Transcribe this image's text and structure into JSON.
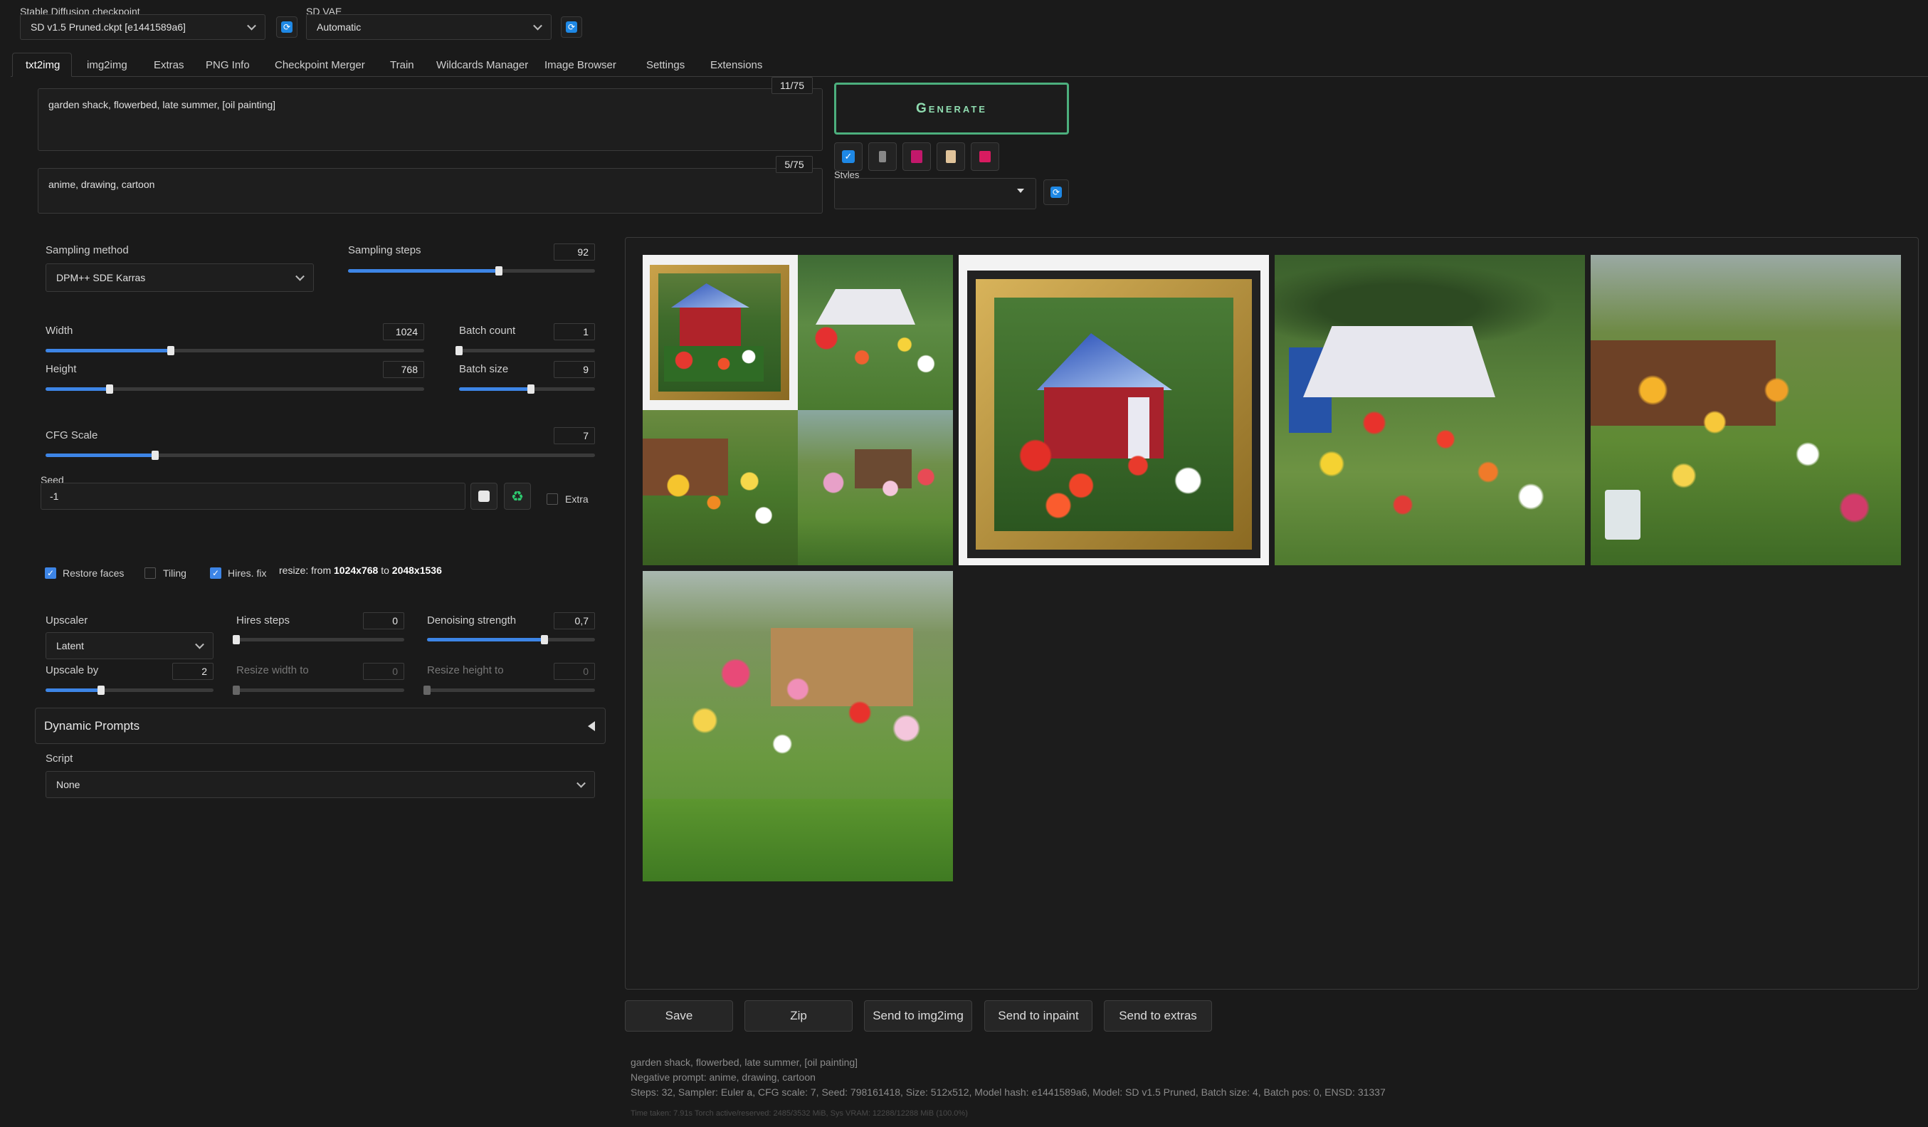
{
  "header": {
    "checkpoint_label": "Stable Diffusion checkpoint",
    "checkpoint_value": "SD v1.5 Pruned.ckpt [e1441589a6]",
    "vae_label": "SD VAE",
    "vae_value": "Automatic"
  },
  "tabs": [
    "txt2img",
    "img2img",
    "Extras",
    "PNG Info",
    "Checkpoint Merger",
    "Train",
    "Wildcards Manager",
    "Image Browser",
    "Settings",
    "Extensions"
  ],
  "prompt": {
    "positive": "garden shack, flowerbed, late summer, [oil painting]",
    "positive_count": "11/75",
    "negative": "anime, drawing, cartoon",
    "negative_count": "5/75"
  },
  "generate_label": "Generate",
  "styles_label": "Styles",
  "sampling": {
    "method_label": "Sampling method",
    "method_value": "DPM++ SDE Karras",
    "steps_label": "Sampling steps",
    "steps_value": "92",
    "steps_fraction": 0.61
  },
  "dims": {
    "width_label": "Width",
    "width_value": "1024",
    "width_fraction": 0.33,
    "height_label": "Height",
    "height_value": "768",
    "height_fraction": 0.17,
    "batch_count_label": "Batch count",
    "batch_count_value": "1",
    "batch_count_fraction": 0.0,
    "batch_size_label": "Batch size",
    "batch_size_value": "9",
    "batch_size_fraction": 0.53
  },
  "cfg": {
    "label": "CFG Scale",
    "value": "7",
    "fraction": 0.2
  },
  "seed": {
    "label": "Seed",
    "value": "-1",
    "extra_label": "Extra"
  },
  "options": {
    "restore_faces": "Restore faces",
    "tiling": "Tiling",
    "hires_fix": "Hires. fix",
    "resize_prefix": "resize: from",
    "resize_from": "1024x768",
    "resize_to_word": "to",
    "resize_to": "2048x1536"
  },
  "hires": {
    "upscaler_label": "Upscaler",
    "upscaler_value": "Latent",
    "steps_label": "Hires steps",
    "steps_value": "0",
    "steps_fraction": 0.0,
    "denoise_label": "Denoising strength",
    "denoise_value": "0,7",
    "denoise_fraction": 0.7,
    "upscale_by_label": "Upscale by",
    "upscale_by_value": "2",
    "upscale_by_fraction": 0.33,
    "resize_w_label": "Resize width to",
    "resize_w_value": "0",
    "resize_h_label": "Resize height to",
    "resize_h_value": "0"
  },
  "dynamic_prompts_label": "Dynamic Prompts",
  "script": {
    "label": "Script",
    "value": "None"
  },
  "output_buttons": [
    "Save",
    "Zip",
    "Send to img2img",
    "Send to inpaint",
    "Send to extras"
  ],
  "info": {
    "line1": "garden shack, flowerbed, late summer, [oil painting]",
    "line2": "Negative prompt: anime, drawing, cartoon",
    "line3": "Steps: 32, Sampler: Euler a, CFG scale: 7, Seed: 798161418, Size: 512x512, Model hash: e1441589a6, Model: SD v1.5 Pruned, Batch size: 4, Batch pos: 0, ENSD: 31337",
    "line4": "Time taken: 7.91s  Torch active/reserved: 2485/3532 MiB, Sys VRAM: 12288/12288 MiB (100.0%)"
  },
  "colors": {
    "accent": "#3d85e6",
    "generate_border": "#4caf7d",
    "background": "#1a1a1a"
  }
}
